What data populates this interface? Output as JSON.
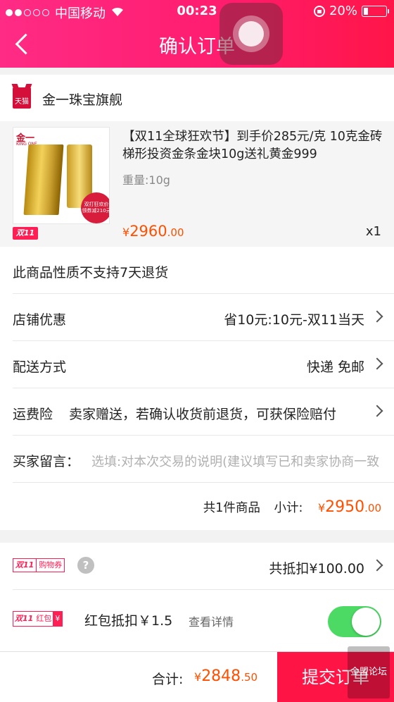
{
  "status_bar": {
    "carrier": "中国移动",
    "time": "00:23",
    "battery": "20%"
  },
  "nav": {
    "title": "确认订单"
  },
  "shop": {
    "badge": "天猫",
    "name": "金一珠宝旗舰"
  },
  "product": {
    "title": "【双11全球狂欢节】到手价285元/克 10克金砖梯形投资金条金块10g送礼黄金999",
    "spec": "重量:10g",
    "price_currency": "¥",
    "price_int": "2960",
    "price_dec": ".00",
    "qty": "x1",
    "event_badge": "双11",
    "thumb_brand": "金一",
    "thumb_brand_sub": "KING ONE",
    "thumb_promo": "双打狂欢价 领券减210元"
  },
  "rows": {
    "no_return": "此商品性质不支持7天退货",
    "shop_discount_label": "店铺优惠",
    "shop_discount_value": "省10元:10元-双11当天",
    "delivery_label": "配送方式",
    "delivery_value": "快递 免邮",
    "insurance_label": "运费险",
    "insurance_value": "卖家赠送，若确认收货前退货，可获保险赔付",
    "message_label": "买家留言：",
    "message_placeholder": "选填:对本次交易的说明(建议填写已和卖家协商一致的内容)",
    "subtotal_count": "共1件商品",
    "subtotal_label": "小计:",
    "subtotal_currency": "¥",
    "subtotal_int": "2950",
    "subtotal_dec": ".00"
  },
  "coupon": {
    "tag_a": "双11",
    "tag_b": "购物券",
    "help": "?",
    "value": "共抵扣¥100.00"
  },
  "red_packet": {
    "tag_a": "双11",
    "tag_b": "红包",
    "tag_c": "¥",
    "label": "红包抵扣￥1.5",
    "link": "查看详情",
    "enabled": true
  },
  "footer": {
    "total_label": "合计:",
    "total_currency": "¥",
    "total_int": "2848",
    "total_dec": ".50",
    "submit_label": "提交订单",
    "watermark": "金盟论坛"
  },
  "colors": {
    "accent": "#ff1446",
    "price": "#ff5000",
    "toggle_on": "#4cd964"
  }
}
